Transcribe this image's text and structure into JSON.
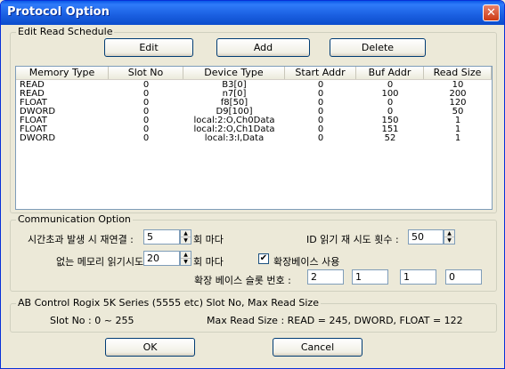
{
  "window": {
    "title": "Protocol Option",
    "close_glyph": "✕"
  },
  "schedule": {
    "legend": "Edit Read Schedule",
    "buttons": {
      "edit": "Edit",
      "add": "Add",
      "delete": "Delete"
    },
    "columns": [
      "Memory Type",
      "Slot No",
      "Device Type",
      "Start Addr",
      "Buf Addr",
      "Read Size"
    ],
    "rows": [
      [
        "READ",
        "0",
        "B3[0]",
        "0",
        "0",
        "10"
      ],
      [
        "READ",
        "0",
        "n7[0]",
        "0",
        "100",
        "200"
      ],
      [
        "FLOAT",
        "0",
        "f8[50]",
        "0",
        "0",
        "120"
      ],
      [
        "DWORD",
        "0",
        "D9[100]",
        "0",
        "0",
        "50"
      ],
      [
        "FLOAT",
        "0",
        "local:2:O,Ch0Data",
        "0",
        "150",
        "1"
      ],
      [
        "FLOAT",
        "0",
        "local:2:O,Ch1Data",
        "0",
        "151",
        "1"
      ],
      [
        "DWORD",
        "0",
        "local:3:I,Data",
        "0",
        "52",
        "1"
      ]
    ]
  },
  "comm": {
    "legend": "Communication Option",
    "reconnect_label": "시간초과 발생 시 재연결 :",
    "reconnect_value": "5",
    "reconnect_suffix": "회 마다",
    "missing_mem_label": "없는 메모리 읽기시도 :",
    "missing_mem_value": "20",
    "missing_mem_suffix": "회 마다",
    "id_retry_label": "ID 읽기 재 시도 횟수 :",
    "id_retry_value": "50",
    "ext_base_label": "확장베이스 사용",
    "ext_base_checked": true,
    "ext_slot_label": "확장 베이스 슬롯 번호 :",
    "ext_slots": [
      "2",
      "1",
      "1",
      "0"
    ]
  },
  "info": {
    "legend": "AB Control Rogix 5K Series (5555 etc) Slot No, Max Read Size",
    "slot_text": "Slot No : 0 ~ 255",
    "max_text": "Max Read Size  : READ = 245, DWORD, FLOAT = 122"
  },
  "footer": {
    "ok": "OK",
    "cancel": "Cancel"
  }
}
